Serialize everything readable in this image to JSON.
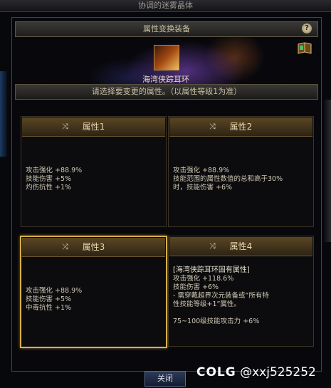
{
  "window_title": "协调的迷雾晶体",
  "header": {
    "title": "属性变换装备",
    "help": "?"
  },
  "item": {
    "name": "海湾侠踪耳环"
  },
  "instruction": "请选择要变更的属性。（以属性等级1为准）",
  "cards": [
    {
      "title": "属性1",
      "lines": [
        {
          "label": "攻击强化",
          "value": "+88.9%"
        },
        {
          "label": "技能伤害",
          "value": "+5%"
        },
        {
          "label": "灼伤抗性",
          "value": "+1%"
        }
      ]
    },
    {
      "title": "属性2",
      "lines": [
        {
          "label": "攻击强化",
          "value": "+88.9%"
        },
        {
          "label": "技能范围的属性数值的总和高于30%",
          "value": ""
        },
        {
          "label": "时，技能伤害",
          "value": "+6%"
        }
      ]
    },
    {
      "title": "属性3",
      "lines": [
        {
          "label": "攻击强化",
          "value": "+88.9%"
        },
        {
          "label": "技能伤害",
          "value": "+5%"
        },
        {
          "label": "中毒抗性",
          "value": "+1%"
        }
      ]
    },
    {
      "title": "属性4",
      "lines": [
        {
          "label": "[海湾侠踪耳环固有属性]",
          "value": ""
        },
        {
          "label": "攻击强化",
          "value": "+118.6%"
        },
        {
          "label": "技能伤害",
          "value": "+6%"
        },
        {
          "label": "- 需穿戴超界次元装备或“所有特",
          "value": ""
        },
        {
          "label": "性技能等级+1”属性。",
          "value": ""
        },
        {
          "label": "",
          "value": ""
        },
        {
          "label": "75~100级技能攻击力",
          "value": "+6%"
        }
      ]
    }
  ],
  "selected_card": "属性3",
  "close_button": "关闭",
  "watermark": {
    "logo": "COLG",
    "user": "@xxj525252"
  }
}
